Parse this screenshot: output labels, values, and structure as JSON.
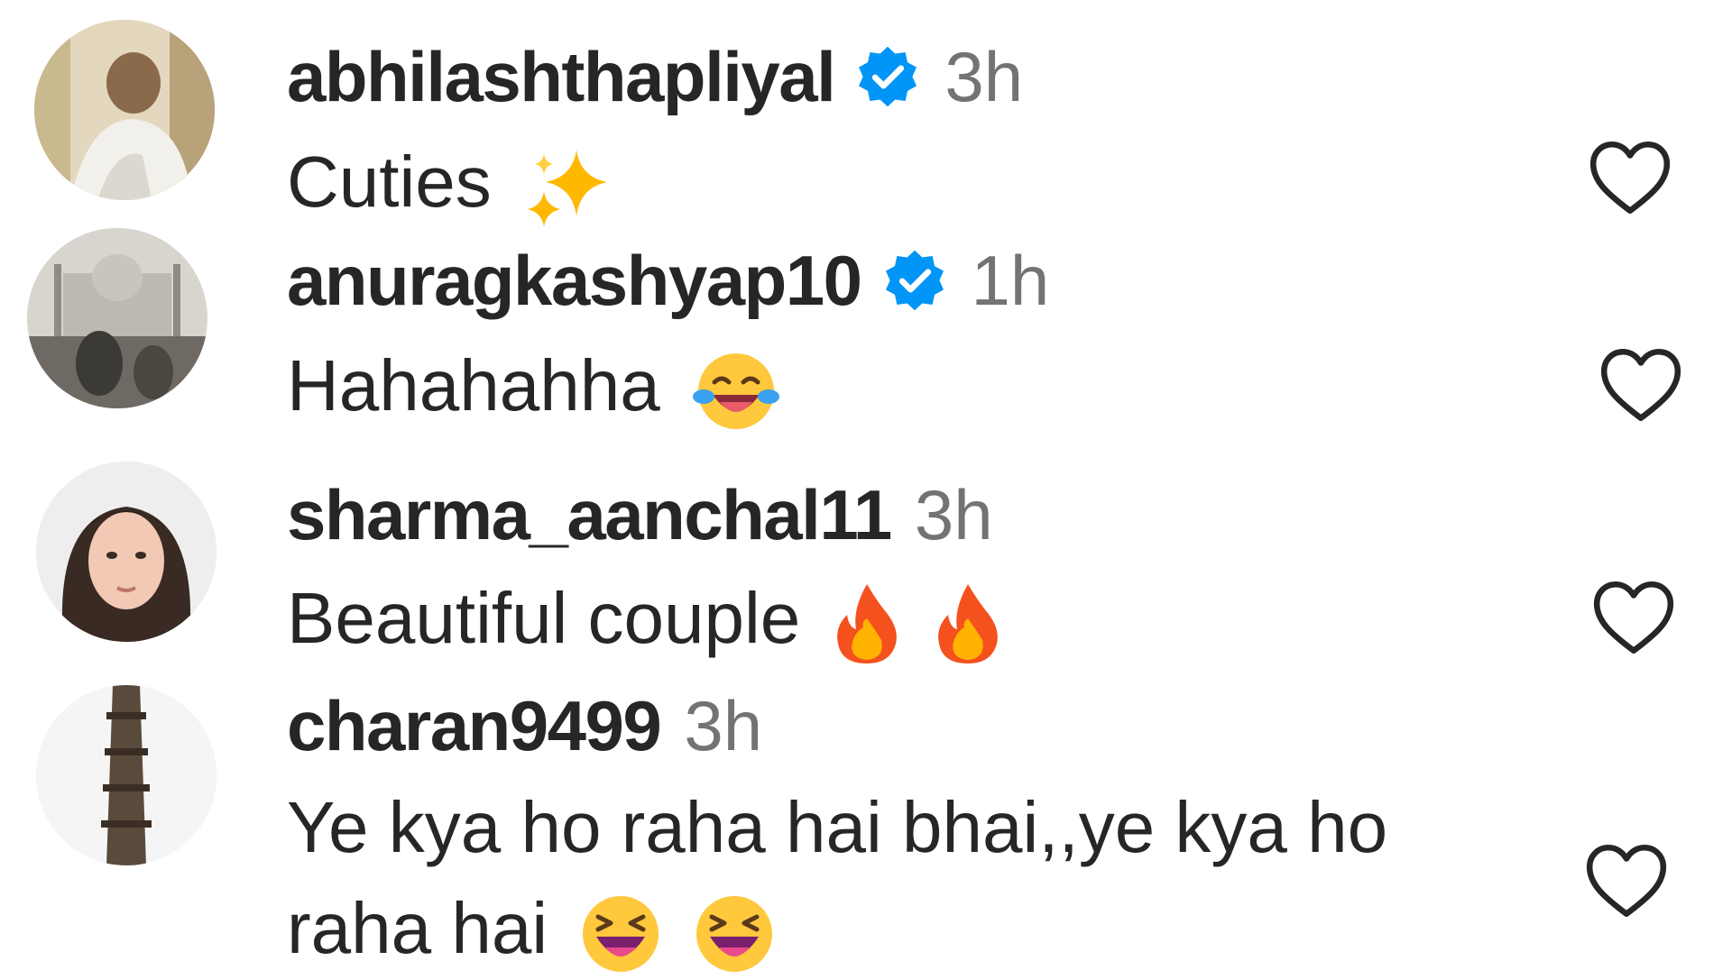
{
  "comments": [
    {
      "username": "abhilashthapliyal",
      "verified": true,
      "time": "3h",
      "text": "Cuties",
      "emojis": [
        "sparkles"
      ],
      "liked": false
    },
    {
      "username": "anuragkashyap10",
      "verified": true,
      "time": "1h",
      "text": "Hahahahha",
      "emojis": [
        "face-with-tears-of-joy"
      ],
      "liked": false
    },
    {
      "username": "sharma_aanchal11",
      "verified": false,
      "time": "3h",
      "text": "Beautiful couple",
      "emojis": [
        "fire",
        "fire"
      ],
      "liked": false
    },
    {
      "username": "charan9499",
      "verified": false,
      "time": "3h",
      "text": "Ye kya ho raha hai bhai,,ye kya ho raha hai",
      "emojis": [
        "grinning-squinting-face",
        "grinning-squinting-face"
      ],
      "liked": false
    }
  ],
  "icons": {
    "verified": "verified-badge-icon",
    "like": "heart-outline-icon"
  },
  "colors": {
    "username": "#262626",
    "timestamp": "#737373",
    "verified": "#0095f6"
  }
}
